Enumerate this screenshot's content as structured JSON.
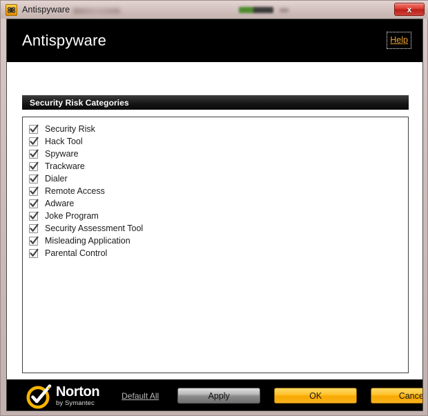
{
  "window": {
    "titlebar": {
      "icon": "antispyware-shield-icon",
      "title": "Antispyware",
      "close_label": "x"
    }
  },
  "header": {
    "title": "Antispyware",
    "help_label": "Help",
    "help_color": "#f0a32a"
  },
  "main": {
    "section_title": "Security Risk Categories",
    "categories": [
      {
        "label": "Security Risk",
        "checked": true
      },
      {
        "label": "Hack Tool",
        "checked": true
      },
      {
        "label": "Spyware",
        "checked": true
      },
      {
        "label": "Trackware",
        "checked": true
      },
      {
        "label": "Dialer",
        "checked": true
      },
      {
        "label": "Remote Access",
        "checked": true
      },
      {
        "label": "Adware",
        "checked": true
      },
      {
        "label": "Joke Program",
        "checked": true
      },
      {
        "label": "Security Assessment Tool",
        "checked": true
      },
      {
        "label": "Misleading Application",
        "checked": true
      },
      {
        "label": "Parental Control",
        "checked": true
      }
    ]
  },
  "footer": {
    "brand_name": "Norton",
    "brand_sub": "by Symantec",
    "brand_color": "#f5b400",
    "default_all_label": "Default All",
    "apply_label": "Apply",
    "ok_label": "OK",
    "cancel_label": "Cancel"
  }
}
